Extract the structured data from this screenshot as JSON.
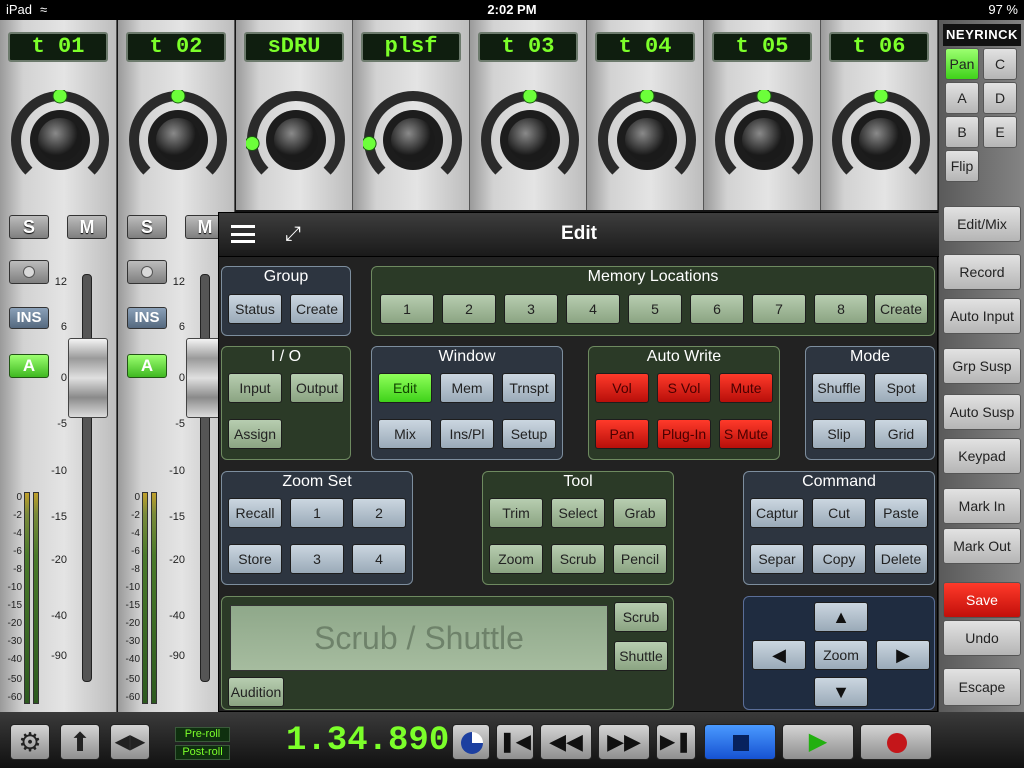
{
  "status_bar": {
    "device": "iPad",
    "time": "2:02 PM",
    "battery": "97 %"
  },
  "channels": [
    {
      "name": "t 01",
      "pan": 0.5
    },
    {
      "name": "t 02",
      "pan": 0.5
    },
    {
      "name": "sDRU",
      "pan": 0.15
    },
    {
      "name": "plsf",
      "pan": 0.15
    },
    {
      "name": "t 03",
      "pan": 0.5
    },
    {
      "name": "t 04",
      "pan": 0.5
    },
    {
      "name": "t 05",
      "pan": 0.5
    },
    {
      "name": "t 06",
      "pan": 0.5
    }
  ],
  "strip_controls": {
    "solo": "S",
    "mute": "M",
    "insert": "INS",
    "auto": "A"
  },
  "fader_scale": [
    "12",
    "6",
    "0",
    "-5",
    "-10",
    "-15",
    "-20",
    "-40",
    "-90"
  ],
  "meter_scale": [
    "0",
    "-2",
    "-4",
    "-6",
    "-8",
    "-10",
    "-15",
    "-20",
    "-30",
    "-40",
    "-50",
    "-60"
  ],
  "right_panel": {
    "brand": "NEYRINCK",
    "pages": [
      {
        "label": "Pan",
        "active": true
      },
      {
        "label": "C"
      },
      {
        "label": "A"
      },
      {
        "label": "D"
      },
      {
        "label": "B"
      },
      {
        "label": "E"
      },
      {
        "label": "Flip"
      }
    ],
    "buttons": [
      "Edit/Mix",
      "Record",
      "Auto Input",
      "Grp Susp",
      "Auto Susp",
      "Keypad",
      "Mark In",
      "Mark Out",
      "Save",
      "Undo",
      "Escape"
    ],
    "save_color": "#e01414"
  },
  "edit": {
    "title": "Edit",
    "group": {
      "title": "Group",
      "buttons": [
        "Status",
        "Create"
      ]
    },
    "memory": {
      "title": "Memory Locations",
      "buttons": [
        "1",
        "2",
        "3",
        "4",
        "5",
        "6",
        "7",
        "8",
        "Create"
      ]
    },
    "io": {
      "title": "I / O",
      "buttons": [
        "Input",
        "Output",
        "Assign"
      ]
    },
    "window": {
      "title": "Window",
      "buttons": [
        "Edit",
        "Mem",
        "Trnspt",
        "Mix",
        "Ins/Pl",
        "Setup"
      ]
    },
    "autowrite": {
      "title": "Auto Write",
      "buttons": [
        "Vol",
        "S Vol",
        "Mute",
        "Pan",
        "Plug-In",
        "S Mute"
      ]
    },
    "mode": {
      "title": "Mode",
      "buttons": [
        "Shuffle",
        "Spot",
        "Slip",
        "Grid"
      ]
    },
    "zoomset": {
      "title": "Zoom Set",
      "buttons": [
        "Recall",
        "1",
        "2",
        "Store",
        "3",
        "4"
      ]
    },
    "tool": {
      "title": "Tool",
      "buttons": [
        "Trim",
        "Select",
        "Grab",
        "Zoom",
        "Scrub",
        "Pencil"
      ]
    },
    "command": {
      "title": "Command",
      "buttons": [
        "Captur",
        "Cut",
        "Paste",
        "Separ",
        "Copy",
        "Delete"
      ]
    },
    "scrub": {
      "display": "Scrub / Shuttle",
      "scrub_button": "Scrub",
      "shuttle_button": "Shuttle",
      "audition_button": "Audition"
    },
    "nav": {
      "zoom": "Zoom"
    }
  },
  "transport": {
    "counter": "1.34.890",
    "preroll": "Pre-roll",
    "postroll": "Post-roll"
  }
}
